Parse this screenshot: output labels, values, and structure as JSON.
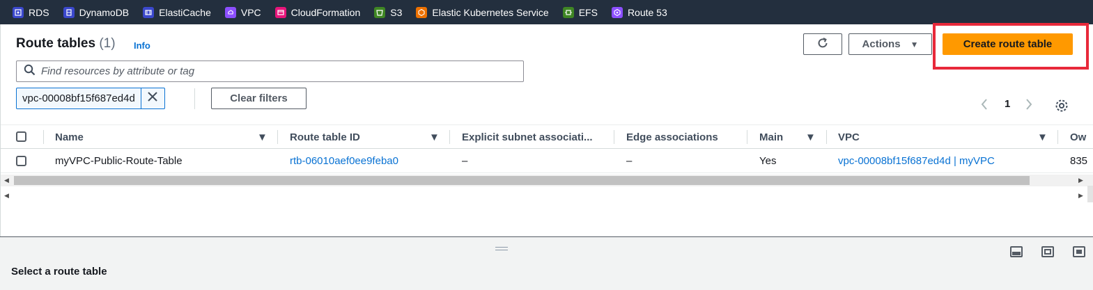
{
  "favorites": [
    {
      "label": "RDS",
      "color": "#3b48cc",
      "icon": "rds-icon"
    },
    {
      "label": "DynamoDB",
      "color": "#3b48cc",
      "icon": "dynamodb-icon"
    },
    {
      "label": "ElastiCache",
      "color": "#3b48cc",
      "icon": "elasticache-icon"
    },
    {
      "label": "VPC",
      "color": "#8c4fff",
      "icon": "vpc-icon"
    },
    {
      "label": "CloudFormation",
      "color": "#e7157b",
      "icon": "cloudformation-icon"
    },
    {
      "label": "S3",
      "color": "#3f8624",
      "icon": "s3-icon"
    },
    {
      "label": "Elastic Kubernetes Service",
      "color": "#ed7100",
      "icon": "eks-icon"
    },
    {
      "label": "EFS",
      "color": "#3f8624",
      "icon": "efs-icon"
    },
    {
      "label": "Route 53",
      "color": "#8c4fff",
      "icon": "route53-icon"
    }
  ],
  "header": {
    "title": "Route tables",
    "count": "(1)",
    "info": "Info",
    "actions_label": "Actions",
    "create_label": "Create route table"
  },
  "filter": {
    "placeholder": "Find resources by attribute or tag",
    "token": "vpc-00008bf15f687ed4d",
    "clear_label": "Clear filters"
  },
  "pagination": {
    "current_page": "1"
  },
  "table": {
    "columns": [
      "Name",
      "Route table ID",
      "Explicit subnet associati...",
      "Edge associations",
      "Main",
      "VPC",
      "Ow"
    ],
    "rows": [
      {
        "name": "myVPC-Public-Route-Table",
        "route_table_id": "rtb-06010aef0ee9feba0",
        "explicit_subnet": "–",
        "edge": "–",
        "main": "Yes",
        "vpc": "vpc-00008bf15f687ed4d | myVPC",
        "owner": "835"
      }
    ]
  },
  "split_panel": {
    "title": "Select a route table"
  },
  "colors": {
    "nav_bg": "#232f3e",
    "primary": "#ff9900",
    "link": "#0972d3",
    "highlight": "#e8293a"
  }
}
